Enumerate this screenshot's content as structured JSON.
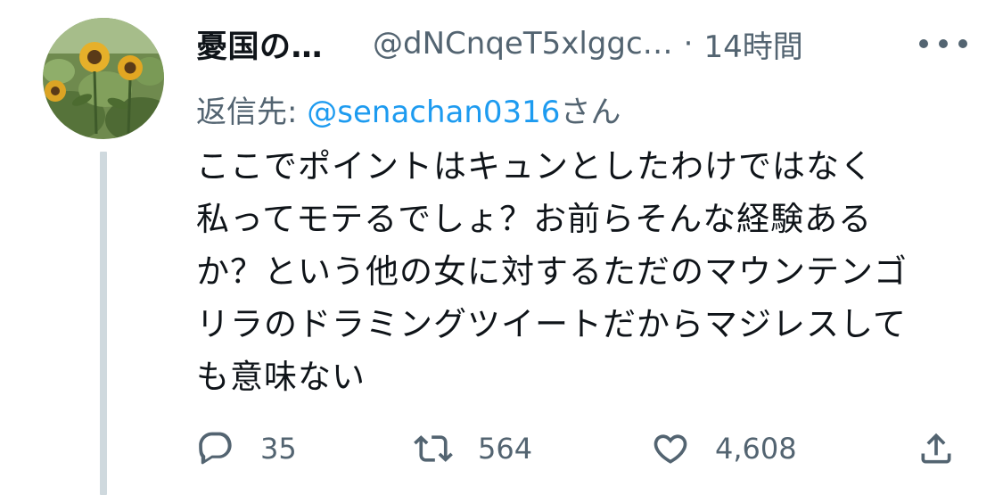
{
  "tweet": {
    "display_name": "憂国の…",
    "handle": "@dNCnqeT5xlggc…",
    "separator": "·",
    "time": "14時間",
    "reply_prefix": "返信先: ",
    "reply_mention": "@senachan0316",
    "reply_suffix": "さん",
    "text_lines": [
      "ここでポイントはキュンとしたわけではなく",
      "私ってモテるでしょ？お前らそんな経験ある",
      "か？という他の女に対するただのマウンテンゴ",
      "リラのドラミングツイートだからマジレスして",
      "も意味ない"
    ]
  },
  "actions": {
    "reply_count": "35",
    "retweet_count": "564",
    "like_count": "4,608"
  },
  "icons": {
    "reply": "reply-icon",
    "retweet": "retweet-icon",
    "like": "heart-icon",
    "share": "share-icon",
    "more": "more-icon",
    "avatar": "sunflower-avatar"
  },
  "colors": {
    "text": "#0f1419",
    "secondary": "#536471",
    "link": "#1d9bf0",
    "thread_line": "#cfd9de"
  }
}
